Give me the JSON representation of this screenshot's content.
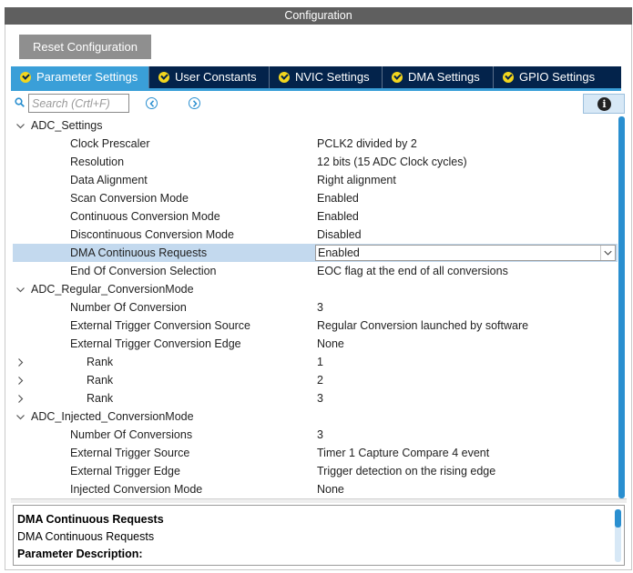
{
  "window": {
    "title": "Configuration"
  },
  "toolbar": {
    "reset_label": "Reset Configuration"
  },
  "tabs": [
    {
      "label": "Parameter Settings",
      "active": true
    },
    {
      "label": "User Constants",
      "active": false
    },
    {
      "label": "NVIC Settings",
      "active": false
    },
    {
      "label": "DMA Settings",
      "active": false
    },
    {
      "label": "GPIO Settings",
      "active": false
    }
  ],
  "search": {
    "placeholder": "Search (Crtl+F)"
  },
  "tree": {
    "adc_settings": {
      "label": "ADC_Settings",
      "rows": [
        {
          "name": "Clock Prescaler",
          "value": "PCLK2 divided by 2"
        },
        {
          "name": "Resolution",
          "value": "12 bits (15 ADC Clock cycles)"
        },
        {
          "name": "Data Alignment",
          "value": "Right alignment"
        },
        {
          "name": "Scan Conversion Mode",
          "value": "Enabled"
        },
        {
          "name": "Continuous Conversion Mode",
          "value": "Enabled"
        },
        {
          "name": "Discontinuous Conversion Mode",
          "value": "Disabled"
        },
        {
          "name": "DMA Continuous Requests",
          "value": "Enabled"
        },
        {
          "name": "End Of Conversion Selection",
          "value": "EOC flag at the end of all conversions"
        }
      ]
    },
    "regular": {
      "label": "ADC_Regular_ConversionMode",
      "rows": [
        {
          "name": "Number Of Conversion",
          "value": "3"
        },
        {
          "name": "External Trigger Conversion Source",
          "value": "Regular Conversion launched by software"
        },
        {
          "name": "External Trigger Conversion Edge",
          "value": "None"
        }
      ],
      "ranks": [
        {
          "name": "Rank",
          "value": "1"
        },
        {
          "name": "Rank",
          "value": "2"
        },
        {
          "name": "Rank",
          "value": "3"
        }
      ]
    },
    "injected": {
      "label": "ADC_Injected_ConversionMode",
      "rows": [
        {
          "name": "Number Of Conversions",
          "value": "3"
        },
        {
          "name": "External Trigger Source",
          "value": "Timer 1 Capture Compare 4 event"
        },
        {
          "name": "External Trigger Edge",
          "value": "Trigger detection on the rising edge"
        },
        {
          "name": "Injected Conversion Mode",
          "value": "None"
        }
      ]
    }
  },
  "description": {
    "title": "DMA Continuous Requests",
    "text": "DMA Continuous Requests",
    "heading": "Parameter Description:"
  },
  "colors": {
    "tab_bar": "#03234b",
    "tab_active": "#3a9fd8",
    "check": "#f2d61e",
    "selection": "#c3d9ee"
  }
}
